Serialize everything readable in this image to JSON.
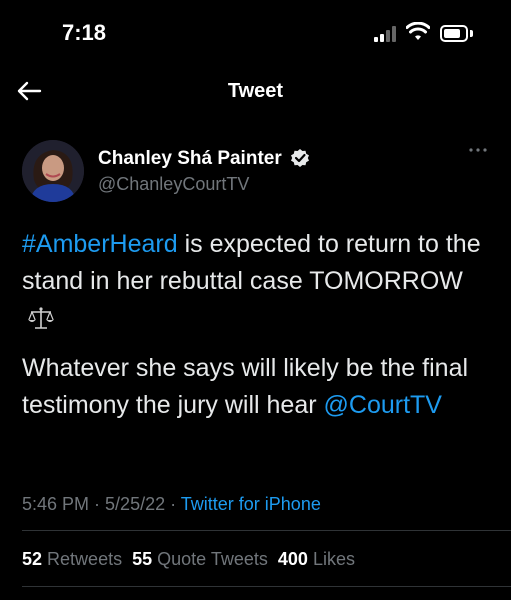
{
  "status_bar": {
    "time": "7:18"
  },
  "nav": {
    "title": "Tweet"
  },
  "author": {
    "name": "Chanley Shá Painter",
    "handle": "@ChanleyCourtTV"
  },
  "tweet": {
    "hashtag": "#AmberHeard",
    "line1_rest": " is expected to return to the stand in her rebuttal case TOMORROW",
    "para2": "Whatever she says will likely be the final testimony the jury will hear ",
    "mention": "@CourtTV"
  },
  "meta": {
    "time": "5:46 PM",
    "sep1": " · ",
    "date": "5/25/22",
    "sep2": " · ",
    "source": "Twitter for iPhone"
  },
  "stats": {
    "retweets_count": "52",
    "retweets_label": "Retweets",
    "quotes_count": "55",
    "quotes_label": "Quote Tweets",
    "likes_count": "400",
    "likes_label": "Likes"
  },
  "icons": {
    "back": "arrow-left-icon",
    "verified": "verified-badge-icon",
    "more": "more-dots-icon",
    "emoji": "balance-scale-icon"
  },
  "colors": {
    "link": "#1d9bf0",
    "muted": "#71767b",
    "background": "#000000"
  }
}
